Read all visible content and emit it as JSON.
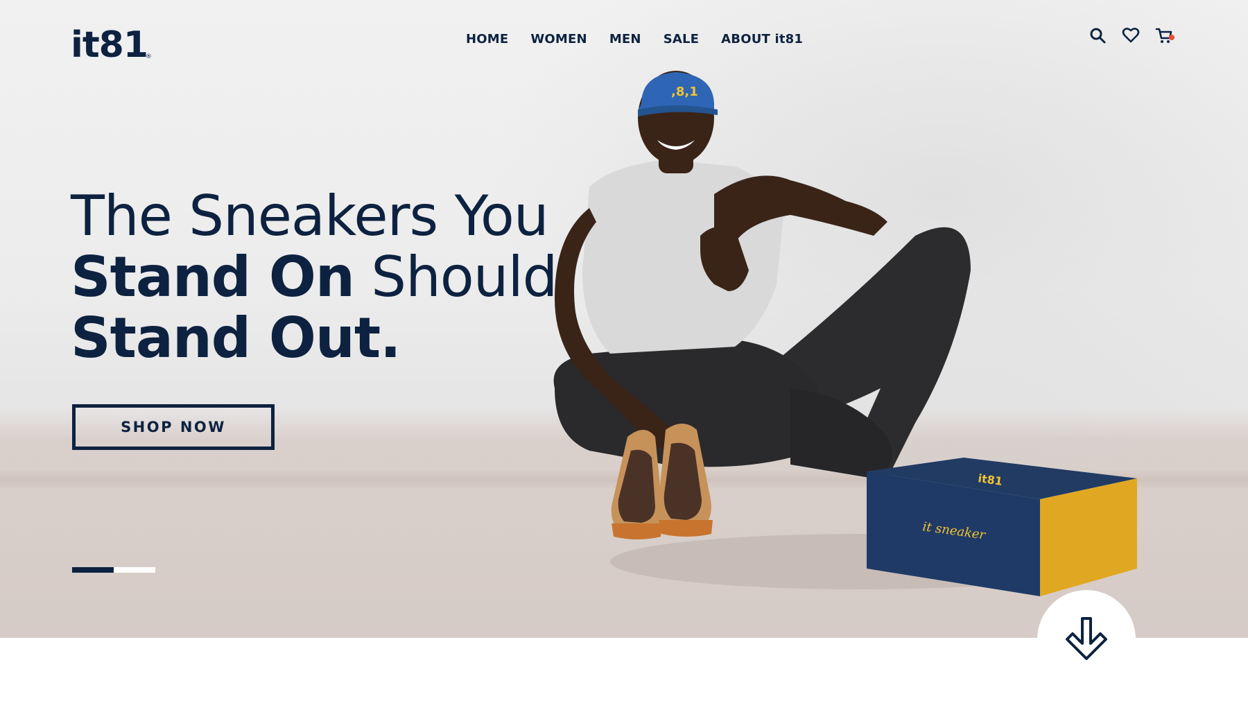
{
  "brand": {
    "logo_text": "it81",
    "registered_mark": "®",
    "primary_color": "#0d2240",
    "accent_color": "#e94d3c"
  },
  "nav": {
    "items": [
      {
        "label": "HOME"
      },
      {
        "label": "WOMEN"
      },
      {
        "label": "MEN"
      },
      {
        "label": "SALE"
      },
      {
        "label": "ABOUT it81"
      }
    ]
  },
  "header_icons": [
    "search-icon",
    "heart-icon",
    "cart-icon"
  ],
  "hero": {
    "line1": "The Sneakers You",
    "line2_bold": "Stand On",
    "line2_light": " Should",
    "line3_bold": "Stand Out.",
    "cta_label": "SHOP NOW",
    "slides_total": 2,
    "slide_active": 1,
    "cap_text": ",8,1",
    "box_brand": "it81",
    "box_tagline": "it sneaker"
  },
  "scroll_icon": "arrow-down-icon"
}
